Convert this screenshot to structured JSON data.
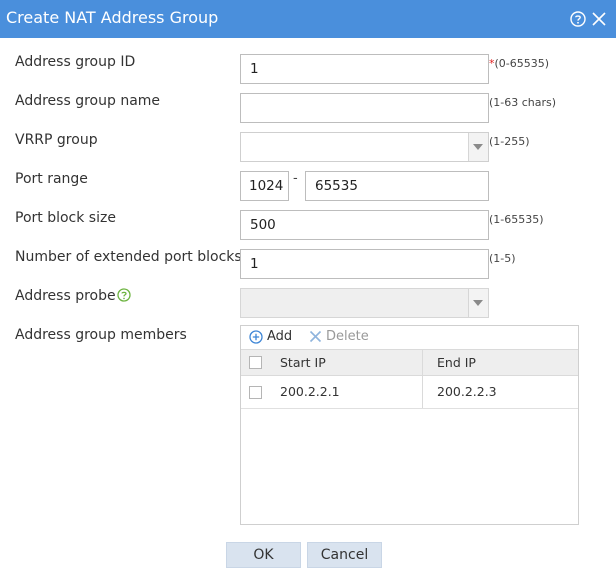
{
  "dialog": {
    "title": "Create NAT Address Group",
    "colors": {
      "titlebar": "#4a8fdc",
      "button": "#d9e3ef"
    }
  },
  "fields": {
    "group_id": {
      "label": "Address group ID",
      "value": "1",
      "required_mark": "*",
      "hint": "(0-65535)"
    },
    "group_name": {
      "label": "Address group name",
      "value": "",
      "hint": "(1-63 chars)"
    },
    "vrrp_group": {
      "label": "VRRP group",
      "value": "",
      "hint": "(1-255)"
    },
    "port_range": {
      "label": "Port range",
      "start": "1024",
      "separator": "-",
      "end": "65535"
    },
    "port_block_size": {
      "label": "Port block size",
      "value": "500",
      "hint": "(1-65535)"
    },
    "extended_blocks": {
      "label": "Number of extended port blocks",
      "value": "1",
      "hint": "(1-5)"
    },
    "address_probe": {
      "label": "Address probe",
      "value": ""
    }
  },
  "members": {
    "label": "Address group members",
    "add_label": "Add",
    "delete_label": "Delete",
    "columns": [
      "Start IP",
      "End IP"
    ],
    "rows": [
      {
        "start_ip": "200.2.2.1",
        "end_ip": "200.2.2.3"
      }
    ]
  },
  "buttons": {
    "ok": "OK",
    "cancel": "Cancel"
  }
}
